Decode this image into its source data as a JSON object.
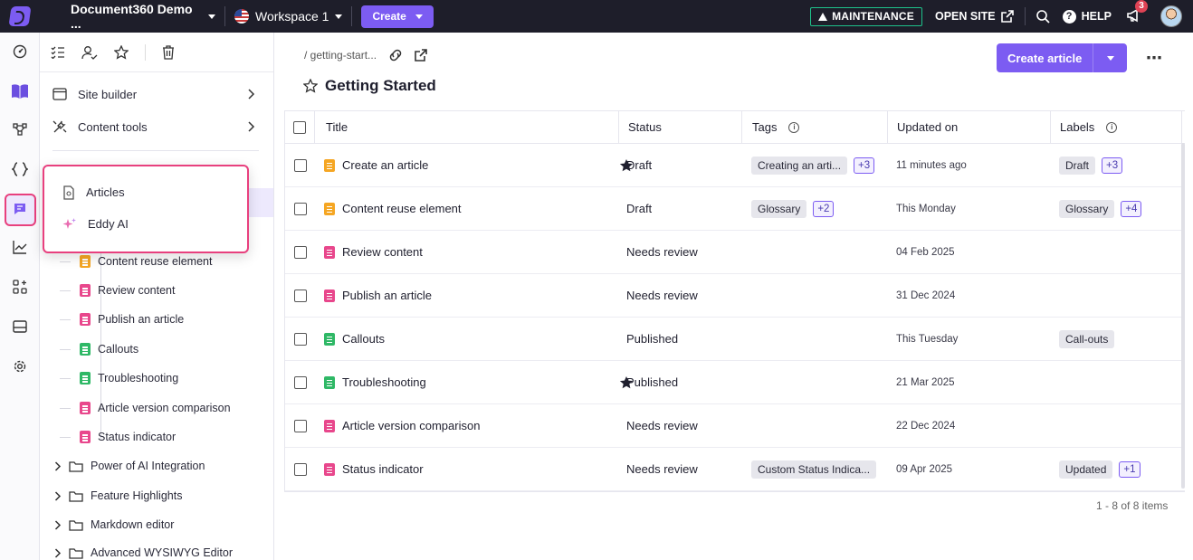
{
  "topbar": {
    "project_name": "Document360 Demo ...",
    "workspace_name": "Workspace 1",
    "create_label": "Create",
    "maintenance_label": "MAINTENANCE",
    "open_site_label": "OPEN SITE",
    "help_label": "HELP",
    "notification_count": "3"
  },
  "sidebar": {
    "menu": [
      {
        "label": "Site builder"
      },
      {
        "label": "Content tools"
      }
    ],
    "popup": [
      {
        "label": "Articles"
      },
      {
        "label": "Eddy AI"
      }
    ],
    "tree": [
      {
        "label": "Content reuse element",
        "status": "draft"
      },
      {
        "label": "Review content",
        "status": "review"
      },
      {
        "label": "Publish an article",
        "status": "review"
      },
      {
        "label": "Callouts",
        "status": "published"
      },
      {
        "label": "Troubleshooting",
        "status": "published"
      },
      {
        "label": "Article version comparison",
        "status": "review"
      },
      {
        "label": "Status indicator",
        "status": "review"
      }
    ],
    "folders": [
      {
        "label": "Power of AI Integration"
      },
      {
        "label": "Feature Highlights"
      },
      {
        "label": "Markdown editor"
      },
      {
        "label": "Advanced WYSIWYG Editor"
      }
    ]
  },
  "main": {
    "breadcrumb": "/ getting-start...",
    "title": "Getting Started",
    "create_article_label": "Create article",
    "table": {
      "headers": {
        "title": "Title",
        "status": "Status",
        "tags": "Tags",
        "updated": "Updated on",
        "labels": "Labels"
      },
      "rows": [
        {
          "title": "Create an article",
          "type": "draft",
          "starred": true,
          "status": "Draft",
          "tag": "Creating an arti...",
          "tag_more": "+3",
          "updated": "11 minutes ago",
          "label": "Draft",
          "label_more": "+3"
        },
        {
          "title": "Content reuse element",
          "type": "draft",
          "starred": false,
          "status": "Draft",
          "tag": "Glossary",
          "tag_more": "+2",
          "updated": "This Monday",
          "label": "Glossary",
          "label_more": "+4"
        },
        {
          "title": "Review content",
          "type": "review",
          "starred": false,
          "status": "Needs review",
          "tag": "",
          "tag_more": "",
          "updated": "04 Feb 2025",
          "label": "",
          "label_more": ""
        },
        {
          "title": "Publish an article",
          "type": "review",
          "starred": false,
          "status": "Needs review",
          "tag": "",
          "tag_more": "",
          "updated": "31 Dec 2024",
          "label": "",
          "label_more": ""
        },
        {
          "title": "Callouts",
          "type": "published",
          "starred": false,
          "status": "Published",
          "tag": "",
          "tag_more": "",
          "updated": "This Tuesday",
          "label": "Call-outs",
          "label_more": ""
        },
        {
          "title": "Troubleshooting",
          "type": "published",
          "starred": true,
          "status": "Published",
          "tag": "",
          "tag_more": "",
          "updated": "21 Mar 2025",
          "label": "",
          "label_more": ""
        },
        {
          "title": "Article version comparison",
          "type": "review",
          "starred": false,
          "status": "Needs review",
          "tag": "",
          "tag_more": "",
          "updated": "22 Dec 2024",
          "label": "",
          "label_more": ""
        },
        {
          "title": "Status indicator",
          "type": "review",
          "starred": false,
          "status": "Needs review",
          "tag": "Custom Status Indica...",
          "tag_more": "",
          "updated": "09 Apr 2025",
          "label": "Updated",
          "label_more": "+1"
        }
      ]
    },
    "pager": "1 - 8 of 8 items"
  },
  "colors": {
    "accent": "#7c5cf2",
    "highlight": "#e8407e",
    "draft": "#f5a623",
    "review": "#e8478c",
    "published": "#2fb866",
    "topbar": "#1e1e2a"
  }
}
